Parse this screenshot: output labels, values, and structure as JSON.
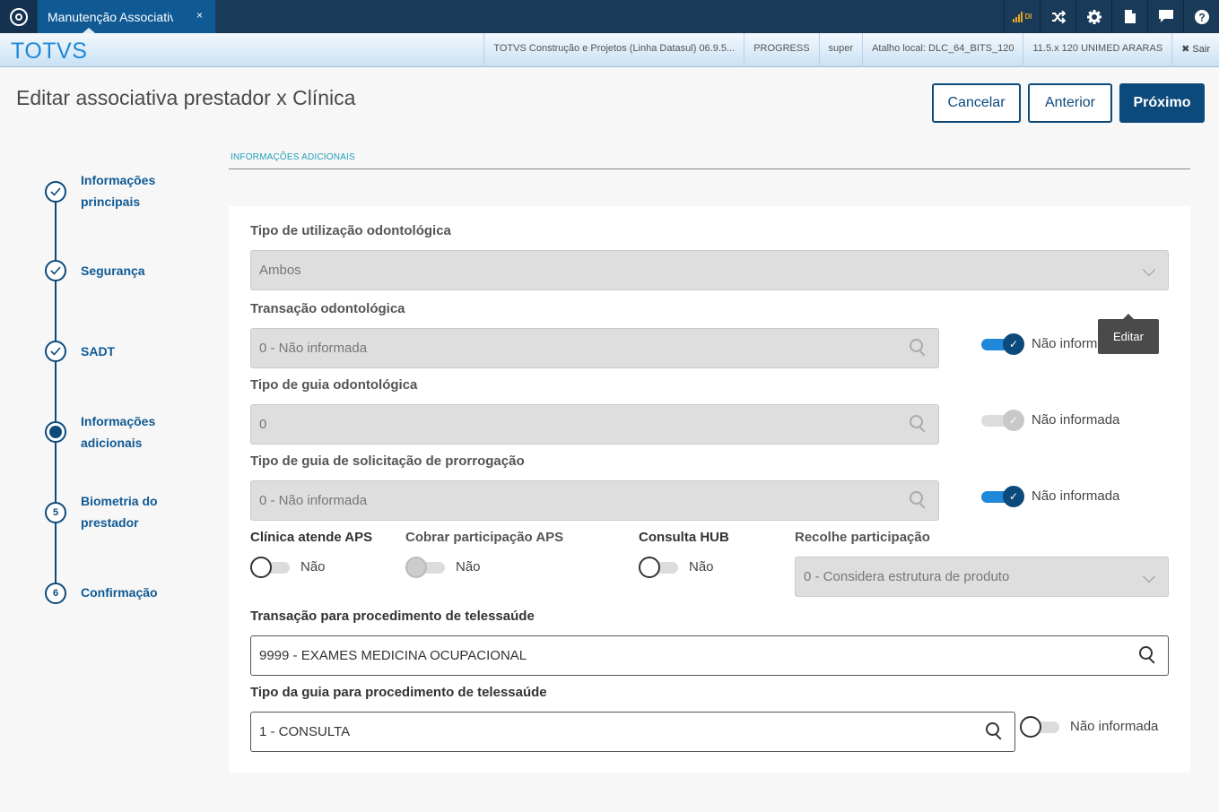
{
  "topbar": {
    "tab_label": "Manutenção Associativ",
    "tab_close": "×",
    "signal_label": "DI"
  },
  "header": {
    "brand": "TOTVS",
    "info": [
      "TOTVS Construção e Projetos (Linha Datasul) 06.9.5...",
      "PROGRESS",
      "super",
      "Atalho local: DLC_64_BITS_120",
      "11.5.x 120 UNIMED ARARAS"
    ],
    "logout": "✖ Sair"
  },
  "page": {
    "title": "Editar associativa prestador x Clínica",
    "cancel": "Cancelar",
    "previous": "Anterior",
    "next": "Próximo"
  },
  "steps": [
    {
      "label_1": "Informações",
      "label_2": "principais",
      "state": "done"
    },
    {
      "label_1": "Segurança",
      "state": "done"
    },
    {
      "label_1": "SADT",
      "state": "done"
    },
    {
      "label_1": "Informações",
      "label_2": "adicionais",
      "state": "current"
    },
    {
      "label_1": "Biometria do",
      "label_2": "prestador",
      "number": "5",
      "state": "pending"
    },
    {
      "label_1": "Confirmação",
      "number": "6",
      "state": "pending"
    }
  ],
  "section": {
    "title": "INFORMAÇÕES ADICIONAIS"
  },
  "form": {
    "tipo_utilizacao": {
      "label": "Tipo de utilização odontológica",
      "value": "Ambos"
    },
    "transacao_odonto": {
      "label": "Transação odontológica",
      "value": "0 - Não informada",
      "toggle_label": "Não informada",
      "toggle_on": true
    },
    "tipo_guia_odonto": {
      "label": "Tipo de guia odontológica",
      "value": "0",
      "toggle_label": "Não informada",
      "toggle_on": true
    },
    "tipo_guia_prorrogacao": {
      "label": "Tipo de guia de solicitação de prorrogação",
      "value": "0 - Não informada",
      "toggle_label": "Não informada",
      "toggle_on": true
    },
    "clinica_aps": {
      "label": "Clínica atende APS",
      "value": "Não"
    },
    "cobrar_aps": {
      "label": "Cobrar participação APS",
      "value": "Não"
    },
    "consulta_hub": {
      "label": "Consulta HUB",
      "value": "Não"
    },
    "recolhe_participacao": {
      "label": "Recolhe participação",
      "value": "0 - Considera estrutura de produto"
    },
    "transacao_telessaude": {
      "label": "Transação para procedimento de telessaúde",
      "value": "9999 - EXAMES MEDICINA OCUPACIONAL"
    },
    "tipo_guia_telessaude": {
      "label": "Tipo da guia para procedimento de telessaúde",
      "value": "1 - CONSULTA",
      "toggle_label": "Não informada",
      "toggle_on": false
    }
  },
  "tooltip": {
    "text": "Editar"
  }
}
